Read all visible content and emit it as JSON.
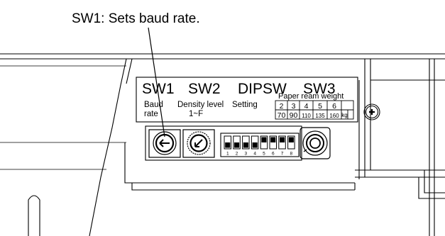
{
  "callout": {
    "text": "SW1: Sets baud rate."
  },
  "panel": {
    "titles": {
      "sw1": "SW1",
      "sw2": "SW2",
      "dipsw": "DIPSW",
      "sw3": "SW3"
    },
    "labels": {
      "sw1_line1": "Baud",
      "sw1_line2": "rate",
      "sw2_line1": "Density level",
      "sw2_line2": "1~F",
      "dipsw": "Setting"
    },
    "paper_ream": {
      "title": "Paper ream weight",
      "settings": [
        "2",
        "3",
        "4",
        "5",
        "6"
      ],
      "weights": [
        "70",
        "90",
        "110",
        "135",
        "160"
      ],
      "unit": "kg"
    },
    "dip_switch": {
      "numbers": [
        "1",
        "2",
        "3",
        "4",
        "5",
        "6",
        "7",
        "8"
      ],
      "positions_on": [
        false,
        false,
        false,
        false,
        true,
        true,
        true,
        true
      ]
    }
  },
  "icons": [
    "rotary-switch-sw1-icon",
    "rotary-switch-sw2-icon",
    "dip-switch-icon",
    "rotary-switch-sw3-icon",
    "phillips-screw-icon"
  ]
}
